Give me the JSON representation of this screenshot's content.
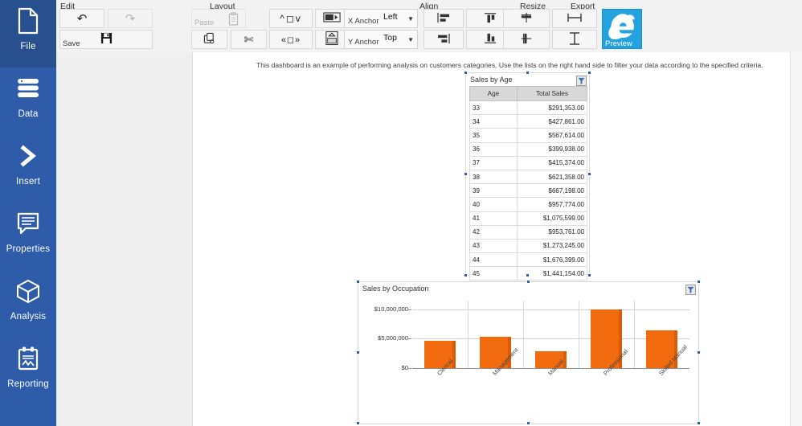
{
  "sidebar": {
    "items": [
      {
        "label": "File",
        "icon": "file-icon",
        "active": true
      },
      {
        "label": "Data",
        "icon": "database-icon",
        "active": false
      },
      {
        "label": "Insert",
        "icon": "chevron-right-icon",
        "active": false
      },
      {
        "label": "Properties",
        "icon": "comment-icon",
        "active": false
      },
      {
        "label": "Analysis",
        "icon": "cube-icon",
        "active": false
      },
      {
        "label": "Reporting",
        "icon": "clipboard-chart-icon",
        "active": false
      }
    ]
  },
  "ribbon": {
    "groups": {
      "edit": "Edit",
      "layout": "Layout",
      "align": "Align",
      "resize": "Resize",
      "export": "Export"
    },
    "edit": {
      "undo": {
        "label": "",
        "icon": "undo-icon"
      },
      "redo": {
        "label": "",
        "icon": "redo-icon"
      },
      "paste": {
        "label": "Paste",
        "icon": "clipboard-icon"
      },
      "save": {
        "label": "Save",
        "icon": "save-disk-icon"
      },
      "copy": {
        "label": "",
        "icon": "copy-icon"
      },
      "cut": {
        "label": "",
        "icon": "scissors-icon"
      }
    },
    "layout": {
      "vertical_order": {
        "icon": "move-vertical-icon"
      },
      "horizontal_order": {
        "icon": "move-horizontal-icon"
      },
      "bring_front": {
        "icon": "bring-to-front-icon"
      },
      "send_back": {
        "icon": "send-to-back-icon"
      },
      "x_anchor_label": "X Anchor",
      "x_anchor_value": "Left",
      "y_anchor_label": "Y Anchor",
      "y_anchor_value": "Top"
    },
    "align": {
      "align_left": {
        "icon": "align-left-icon"
      },
      "align_top": {
        "icon": "align-top-icon"
      },
      "align_center_h": {
        "icon": "align-center-horizontal-icon"
      },
      "align_right": {
        "icon": "align-right-icon"
      },
      "align_bottom": {
        "icon": "align-bottom-icon"
      },
      "align_center_v": {
        "icon": "align-center-vertical-icon"
      }
    },
    "resize": {
      "same_width": {
        "icon": "resize-width-icon"
      },
      "same_height": {
        "icon": "resize-height-icon"
      }
    },
    "export": {
      "label": "Preview",
      "icon": "internet-explorer-icon",
      "color": "#22a3e0"
    }
  },
  "page": {
    "description": "This dashboard is an example of performing analysis on customers categories. Use the lists on the right hand side to filter your data according to the specified criteria."
  },
  "table_widget": {
    "title": "Sales by Age",
    "filter_icon": "filter-icon",
    "columns": [
      "Age",
      "Total Sales"
    ],
    "rows": [
      [
        "33",
        "$291,353.00"
      ],
      [
        "34",
        "$427,861.00"
      ],
      [
        "35",
        "$567,614.00"
      ],
      [
        "36",
        "$399,938.00"
      ],
      [
        "37",
        "$415,374.00"
      ],
      [
        "38",
        "$621,358.00"
      ],
      [
        "39",
        "$667,198.00"
      ],
      [
        "40",
        "$957,774.00"
      ],
      [
        "41",
        "$1,075,599.00"
      ],
      [
        "42",
        "$953,761.00"
      ],
      [
        "43",
        "$1,273,245.00"
      ],
      [
        "44",
        "$1,676,399.00"
      ],
      [
        "45",
        "$1,441,154.00"
      ]
    ]
  },
  "chart_widget": {
    "title": "Sales by Occupation",
    "filter_icon": "filter-icon"
  },
  "chart_data": {
    "type": "bar",
    "title": "Sales by Occupation",
    "categories": [
      "Clerical",
      "Management",
      "Manual",
      "Professional",
      "Skilled Manual"
    ],
    "values": [
      4700000,
      5400000,
      2900000,
      9950000,
      6500000
    ],
    "xlabel": "",
    "ylabel": "",
    "ylim": [
      0,
      11500000
    ],
    "ytick_values": [
      0,
      5000000,
      10000000
    ],
    "ytick_labels": [
      "$0",
      "$5,000,000",
      "$10,000,000"
    ],
    "bar_color": "#f26b0f",
    "grid": true,
    "legend": false
  }
}
